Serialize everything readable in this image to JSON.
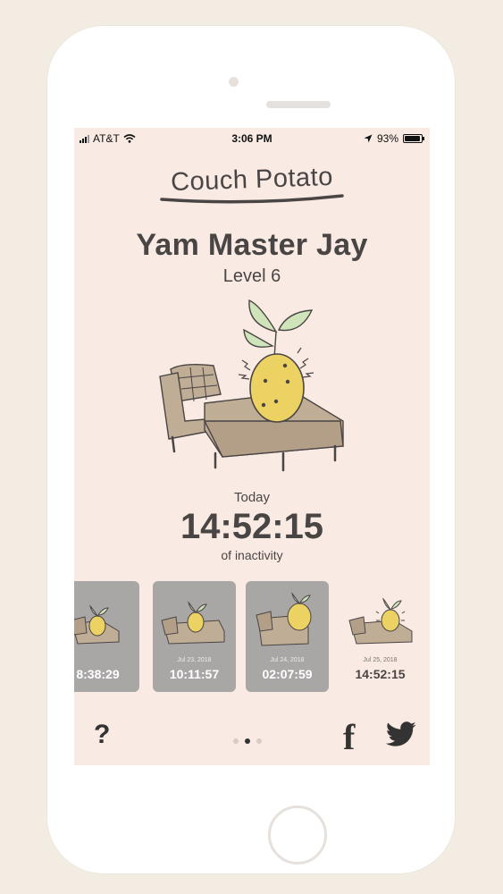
{
  "status_bar": {
    "carrier": "AT&T",
    "time": "3:06 PM",
    "battery": "93%",
    "battery_level": 0.93
  },
  "app": {
    "logo": "Couch Potato"
  },
  "player": {
    "name": "Yam Master Jay",
    "level": "Level 6"
  },
  "today": {
    "label": "Today",
    "duration": "14:52:15",
    "caption": "of inactivity"
  },
  "history": [
    {
      "date": "",
      "duration": "8:38:29"
    },
    {
      "date": "Jul 23, 2018",
      "duration": "10:11:57"
    },
    {
      "date": "Jul 24, 2018",
      "duration": "02:07:59"
    },
    {
      "date": "Jul 25, 2018",
      "duration": "14:52:15"
    }
  ],
  "footer": {
    "help_label": "?",
    "facebook_label": "f",
    "page_count": 3,
    "active_page": 2
  },
  "colors": {
    "screen_bg": "#f9ebe3",
    "text": "#4a4545",
    "couch": "#c0ad96",
    "potato": "#ecd163",
    "leaf": "#cfe4b9",
    "card_gray": "#a9a6a6"
  },
  "icons": [
    "signal-bars-icon",
    "wifi-icon",
    "location-arrow-icon",
    "battery-icon",
    "couch-potato-illustration",
    "help-icon",
    "facebook-icon",
    "twitter-icon"
  ]
}
